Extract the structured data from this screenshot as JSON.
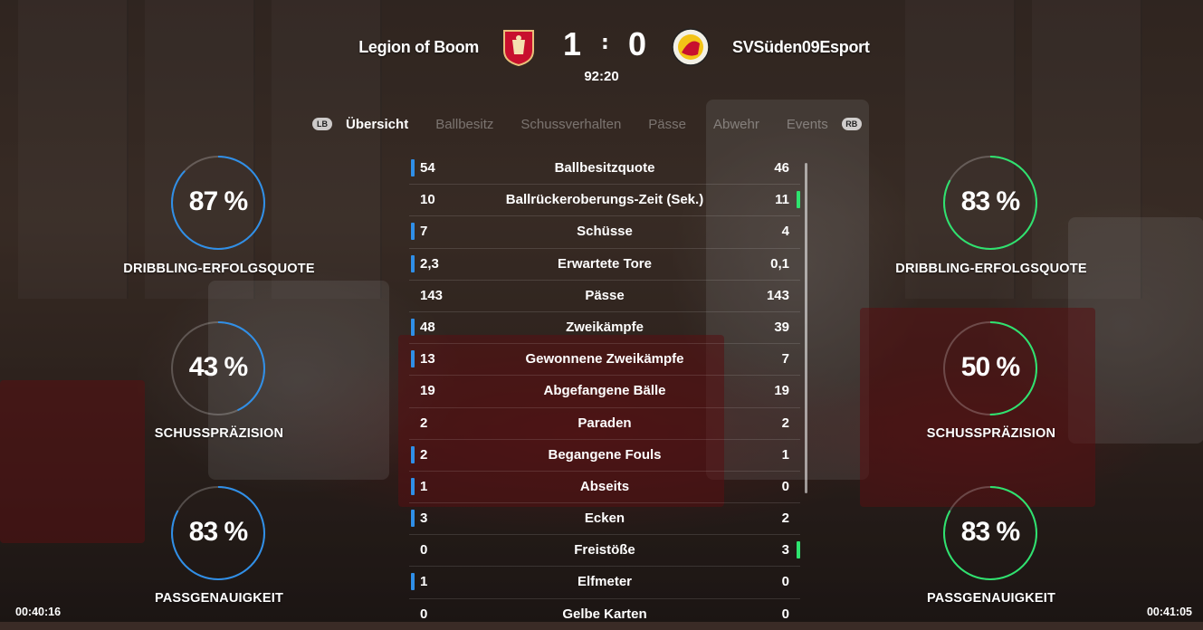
{
  "match": {
    "home_team": "Legion of Boom",
    "away_team": "SVSüden09Esport",
    "home_score": "1",
    "separator": ":",
    "away_score": "0",
    "clock": "92:20",
    "home_crest_icon": "liverpool-crest-icon",
    "away_crest_icon": "svsueden-crest-icon"
  },
  "tabs": {
    "left_bumper": "LB",
    "right_bumper": "RB",
    "items": [
      "Übersicht",
      "Ballbesitz",
      "Schussverhalten",
      "Pässe",
      "Abwehr",
      "Events"
    ],
    "active": 0
  },
  "rings": {
    "left": [
      {
        "value": "87 %",
        "percent": 87,
        "label": "DRIBBLING-ERFOLGSQUOTE"
      },
      {
        "value": "43 %",
        "percent": 43,
        "label": "SCHUSSPRÄZISION"
      },
      {
        "value": "83 %",
        "percent": 83,
        "label": "PASSGENAUIGKEIT"
      }
    ],
    "right": [
      {
        "value": "83 %",
        "percent": 83,
        "label": "DRIBBLING-ERFOLGSQUOTE"
      },
      {
        "value": "50 %",
        "percent": 50,
        "label": "SCHUSSPRÄZISION"
      },
      {
        "value": "83 %",
        "percent": 83,
        "label": "PASSGENAUIGKEIT"
      }
    ]
  },
  "stats": [
    {
      "left": "54",
      "label": "Ballbesitzquote",
      "right": "46",
      "leader": "left"
    },
    {
      "left": "10",
      "label": "Ballrückeroberungs-Zeit (Sek.)",
      "right": "11",
      "leader": "right"
    },
    {
      "left": "7",
      "label": "Schüsse",
      "right": "4",
      "leader": "left"
    },
    {
      "left": "2,3",
      "label": "Erwartete Tore",
      "right": "0,1",
      "leader": "left"
    },
    {
      "left": "143",
      "label": "Pässe",
      "right": "143",
      "leader": "none"
    },
    {
      "left": "48",
      "label": "Zweikämpfe",
      "right": "39",
      "leader": "left"
    },
    {
      "left": "13",
      "label": "Gewonnene Zweikämpfe",
      "right": "7",
      "leader": "left"
    },
    {
      "left": "19",
      "label": "Abgefangene Bälle",
      "right": "19",
      "leader": "none"
    },
    {
      "left": "2",
      "label": "Paraden",
      "right": "2",
      "leader": "none"
    },
    {
      "left": "2",
      "label": "Begangene Fouls",
      "right": "1",
      "leader": "left"
    },
    {
      "left": "1",
      "label": "Abseits",
      "right": "0",
      "leader": "left"
    },
    {
      "left": "3",
      "label": "Ecken",
      "right": "2",
      "leader": "left"
    },
    {
      "left": "0",
      "label": "Freistöße",
      "right": "3",
      "leader": "right"
    },
    {
      "left": "1",
      "label": "Elfmeter",
      "right": "0",
      "leader": "left"
    },
    {
      "left": "0",
      "label": "Gelbe Karten",
      "right": "0",
      "leader": "none"
    }
  ],
  "timestamps": {
    "left": "00:40:16",
    "right": "00:41:05"
  },
  "colors": {
    "home_accent": "#2f8fe8",
    "away_accent": "#2ee36f",
    "ring_track": "rgba(255,255,255,0.22)"
  }
}
